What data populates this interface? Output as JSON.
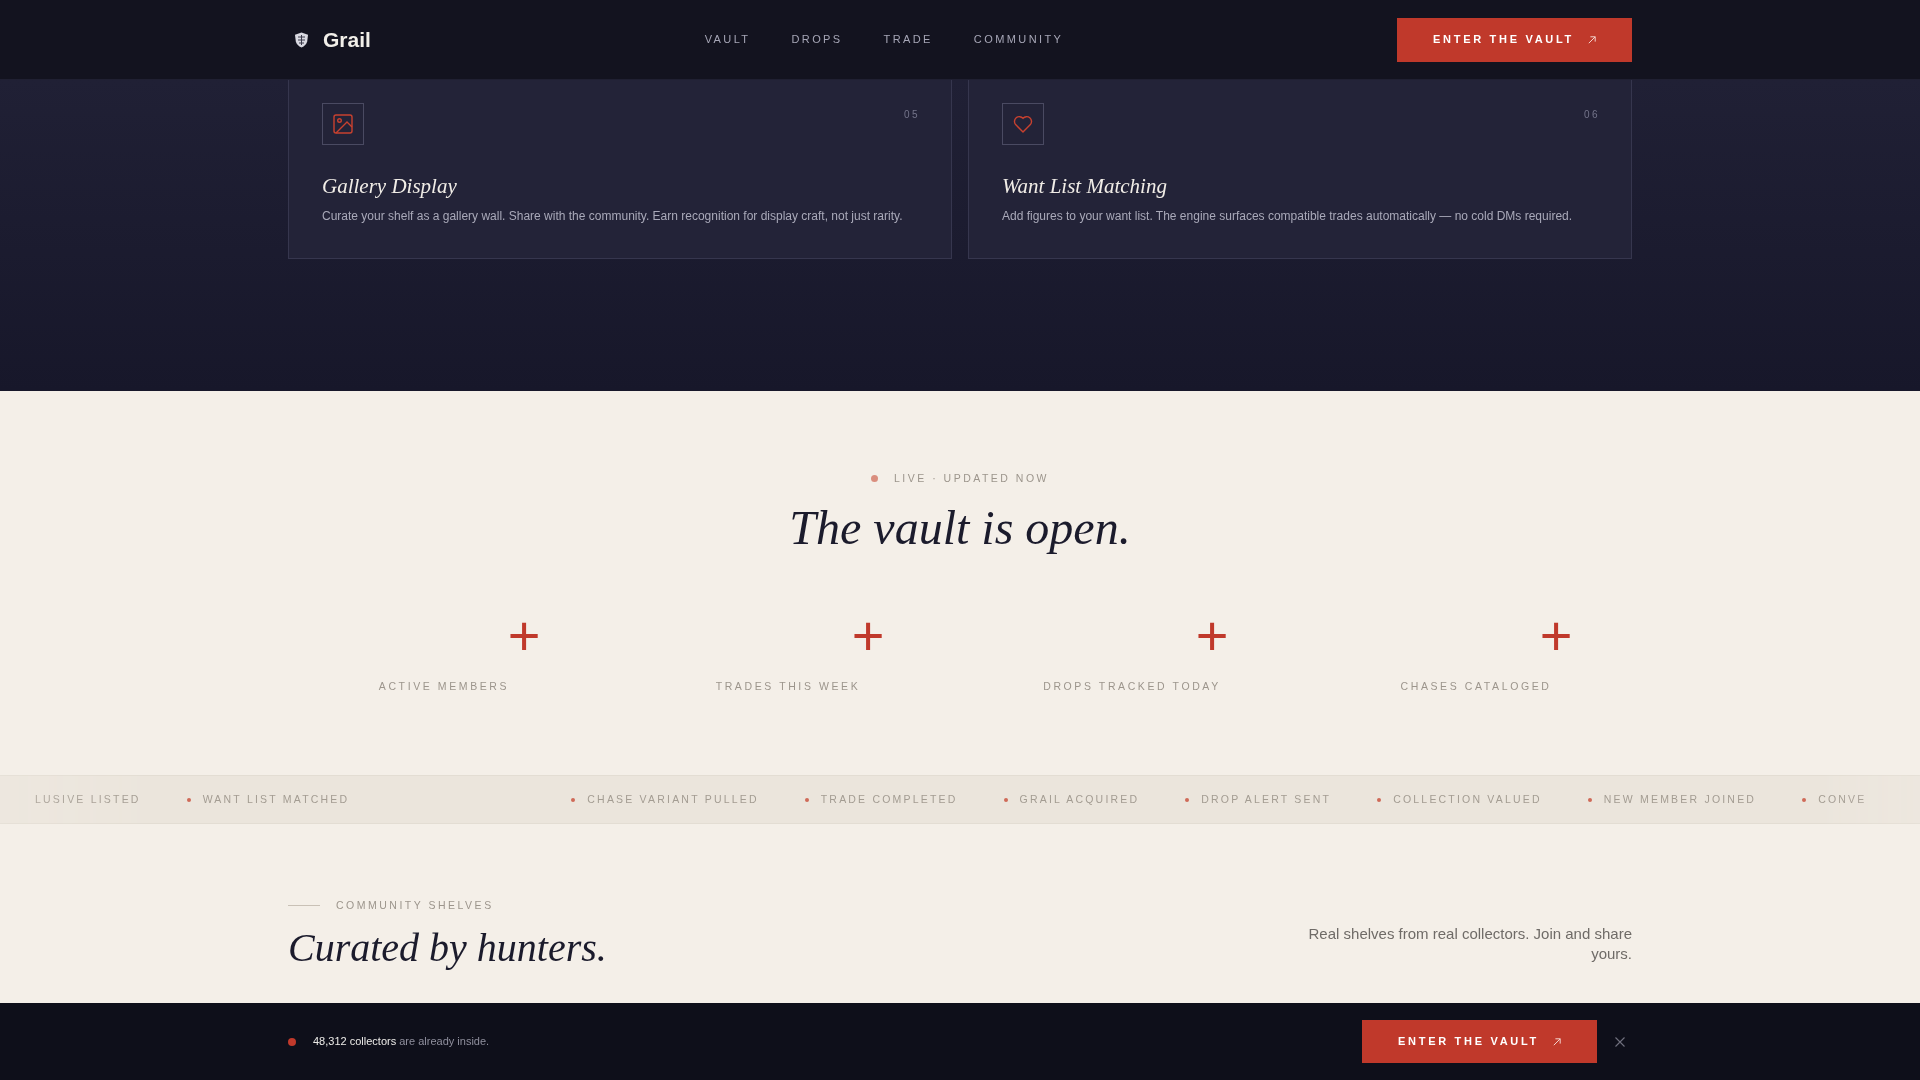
{
  "nav": {
    "brand": "Grail",
    "links": [
      "VAULT",
      "DROPS",
      "TRADE",
      "COMMUNITY"
    ],
    "cta": "ENTER THE VAULT"
  },
  "features": [
    {
      "number": "05",
      "title": "Gallery Display",
      "description": "Curate your shelf as a gallery wall. Share with the community. Earn recognition for display craft, not just rarity."
    },
    {
      "number": "06",
      "title": "Want List Matching",
      "description": "Add figures to your want list. The engine surfaces compatible trades automatically — no cold DMs required."
    }
  ],
  "live": {
    "label": "LIVE · UPDATED NOW",
    "heading": "The vault is open.",
    "stats": [
      {
        "suffix": "+",
        "label": "ACTIVE MEMBERS"
      },
      {
        "suffix": "+",
        "label": "TRADES THIS WEEK"
      },
      {
        "suffix": "+",
        "label": "DROPS TRACKED TODAY"
      },
      {
        "suffix": "+",
        "label": "CHASES CATALOGED"
      }
    ]
  },
  "ticker": [
    "LUSIVE LISTED",
    "WANT LIST MATCHED",
    "CHASE VARIANT PULLED",
    "TRADE COMPLETED",
    "GRAIL ACQUIRED",
    "DROP ALERT SENT",
    "COLLECTION VALUED",
    "NEW MEMBER JOINED",
    "CONVE"
  ],
  "community": {
    "eyebrow": "COMMUNITY SHELVES",
    "heading": "Curated by hunters.",
    "blurb": "Real shelves from real collectors. Join and share yours."
  },
  "banner": {
    "text": "**48,312 collectors** are already inside.",
    "cta": "ENTER THE VAULT"
  }
}
